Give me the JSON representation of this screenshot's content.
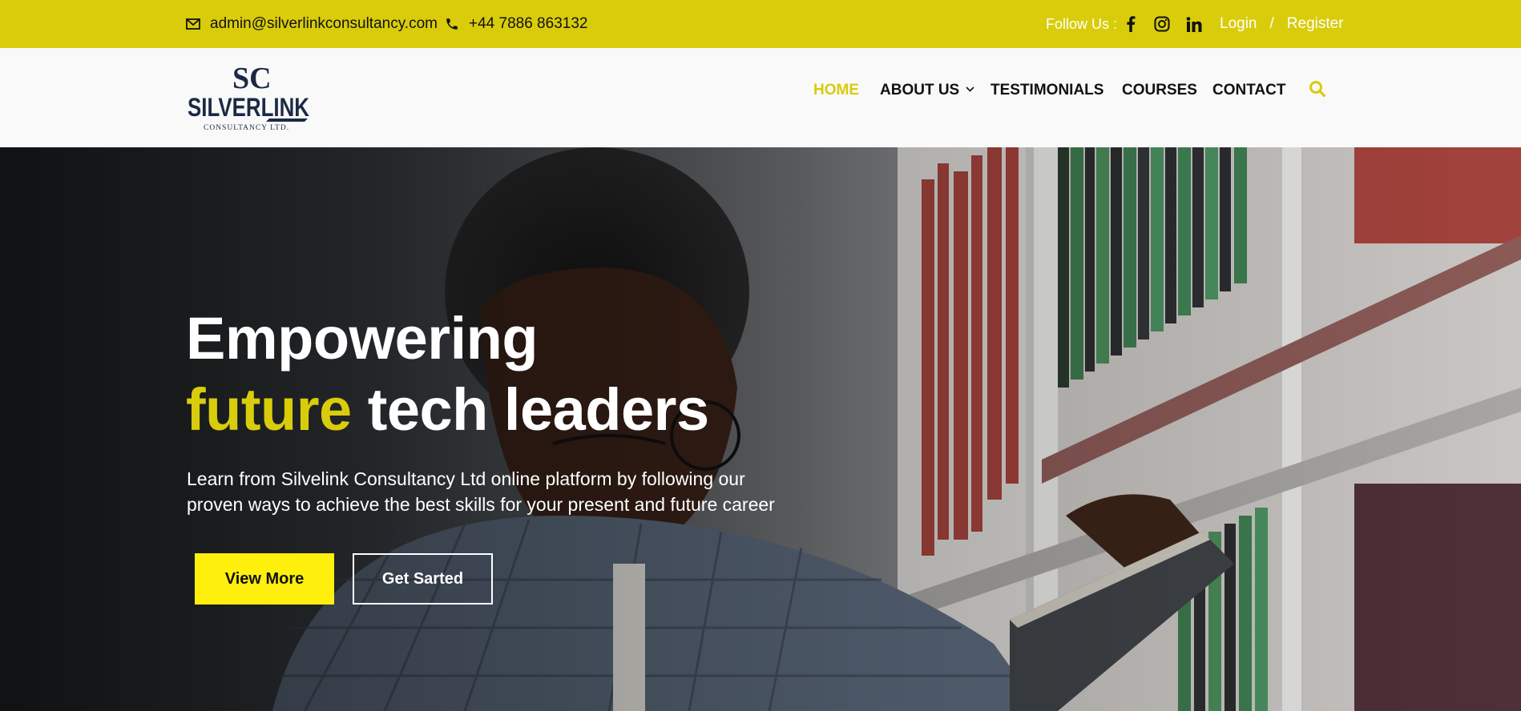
{
  "topbar": {
    "email": "admin@silverlinkconsultancy.com",
    "phone": "+44 7886 863132",
    "follow_label": "Follow Us :",
    "social": [
      "facebook-icon",
      "instagram-icon",
      "linkedin-icon"
    ],
    "login": "Login",
    "separator": "/",
    "register": "Register"
  },
  "header": {
    "logo_mark": "SC",
    "logo_name": "SILVERLINK",
    "logo_sub": "CONSULTANCY LTD.",
    "nav": {
      "home": "HOME",
      "about": "ABOUT US",
      "testimonials": "TESTIMONIALS",
      "courses": "COURSES",
      "contact": "CONTACT"
    },
    "search_icon": "search-icon"
  },
  "hero": {
    "title_line1": "Empowering",
    "title_highlight": "future",
    "title_rest": "tech leaders",
    "subtitle_line1": "Learn from Silvelink Consultancy Ltd online platform by following our",
    "subtitle_line2": "proven ways to achieve the best skills for your present and future career",
    "btn_primary": "View More",
    "btn_secondary": "Get Sarted"
  },
  "colors": {
    "accent": "#d9cc0b",
    "button_yellow": "#ffef0c",
    "logo_navy": "#1b2a44"
  }
}
